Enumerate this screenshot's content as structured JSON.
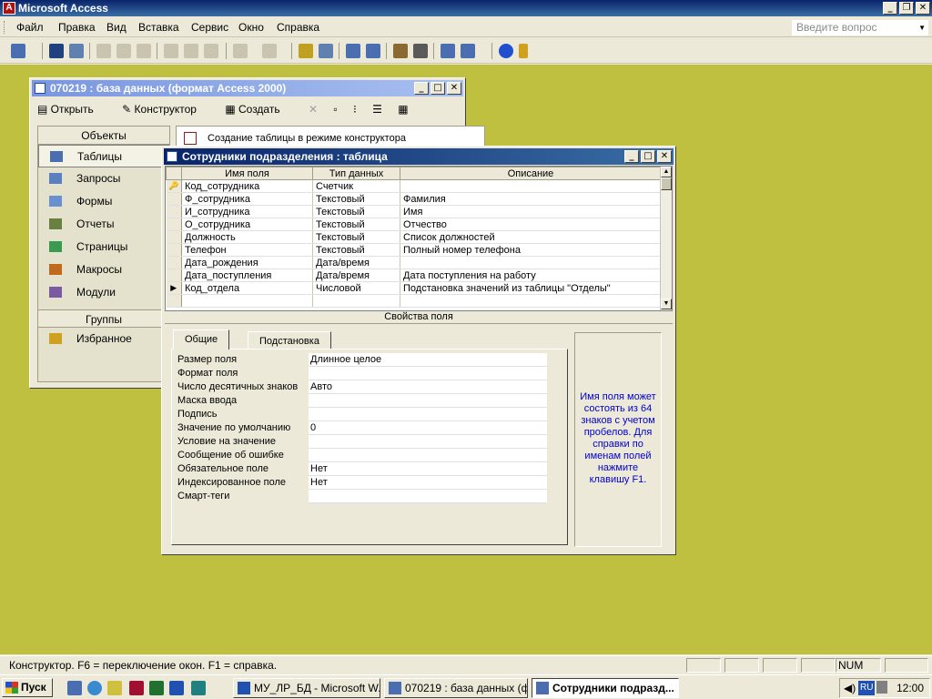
{
  "app": {
    "title": "Microsoft Access",
    "icon": "access-icon"
  },
  "menu": {
    "items": [
      "Файл",
      "Правка",
      "Вид",
      "Вставка",
      "Сервис",
      "Окно",
      "Справка"
    ],
    "help_placeholder": "Введите вопрос"
  },
  "db_window": {
    "title": "070219 : база данных (формат Access 2000)",
    "toolbar": {
      "open": "Открыть",
      "design": "Конструктор",
      "create": "Создать"
    },
    "objects_header": "Объекты",
    "objects": [
      "Таблицы",
      "Запросы",
      "Формы",
      "Отчеты",
      "Страницы",
      "Макросы",
      "Модули"
    ],
    "groups_header": "Группы",
    "groups": [
      "Избранное"
    ],
    "list_first": "Создание таблицы в режиме конструктора"
  },
  "table_window": {
    "title": "Сотрудники подразделения : таблица",
    "columns": [
      "Имя поля",
      "Тип данных",
      "Описание"
    ],
    "rows": [
      {
        "name": "Код_сотрудника",
        "type": "Счетчик",
        "desc": "",
        "key": true
      },
      {
        "name": "Ф_сотрудника",
        "type": "Текстовый",
        "desc": "Фамилия"
      },
      {
        "name": "И_сотрудника",
        "type": "Текстовый",
        "desc": "Имя"
      },
      {
        "name": "О_сотрудника",
        "type": "Текстовый",
        "desc": "Отчество"
      },
      {
        "name": "Должность",
        "type": "Текстовый",
        "desc": "Список должностей"
      },
      {
        "name": "Телефон",
        "type": "Текстовый",
        "desc": "Полный номер телефона"
      },
      {
        "name": "Дата_рождения",
        "type": "Дата/время",
        "desc": ""
      },
      {
        "name": "Дата_поступления",
        "type": "Дата/время",
        "desc": "Дата поступления на работу"
      },
      {
        "name": "Код_отдела",
        "type": "Числовой",
        "desc": "Подстановка значений из таблицы \"Отделы\"",
        "current": true
      }
    ],
    "props_title": "Свойства поля",
    "tabs": [
      "Общие",
      "Подстановка"
    ],
    "properties": [
      {
        "label": "Размер поля",
        "value": "Длинное целое"
      },
      {
        "label": "Формат поля",
        "value": ""
      },
      {
        "label": "Число десятичных знаков",
        "value": "Авто"
      },
      {
        "label": "Маска ввода",
        "value": ""
      },
      {
        "label": "Подпись",
        "value": ""
      },
      {
        "label": "Значение по умолчанию",
        "value": "0"
      },
      {
        "label": "Условие на значение",
        "value": ""
      },
      {
        "label": "Сообщение об ошибке",
        "value": ""
      },
      {
        "label": "Обязательное поле",
        "value": "Нет"
      },
      {
        "label": "Индексированное поле",
        "value": "Нет"
      },
      {
        "label": "Смарт-теги",
        "value": ""
      }
    ],
    "help_text": "Имя поля может состоять из 64 знаков с учетом пробелов. Для справки по именам полей нажмите клавишу F1."
  },
  "status": {
    "text": "Конструктор.  F6 = переключение окон.  F1 = справка.",
    "num": "NUM"
  },
  "taskbar": {
    "start": "Пуск",
    "tasks": [
      "МУ_ЛР_БД - Microsoft W...",
      "070219 : база данных (ф...",
      "Сотрудники подразд..."
    ],
    "lang": "RU",
    "clock": "12:00"
  },
  "colors": {
    "desktop": "#C0C040",
    "title_active": "#0A246A",
    "title_inactive": "#7A96DF",
    "chrome": "#ECE9D8",
    "help_text": "#0000CC"
  }
}
